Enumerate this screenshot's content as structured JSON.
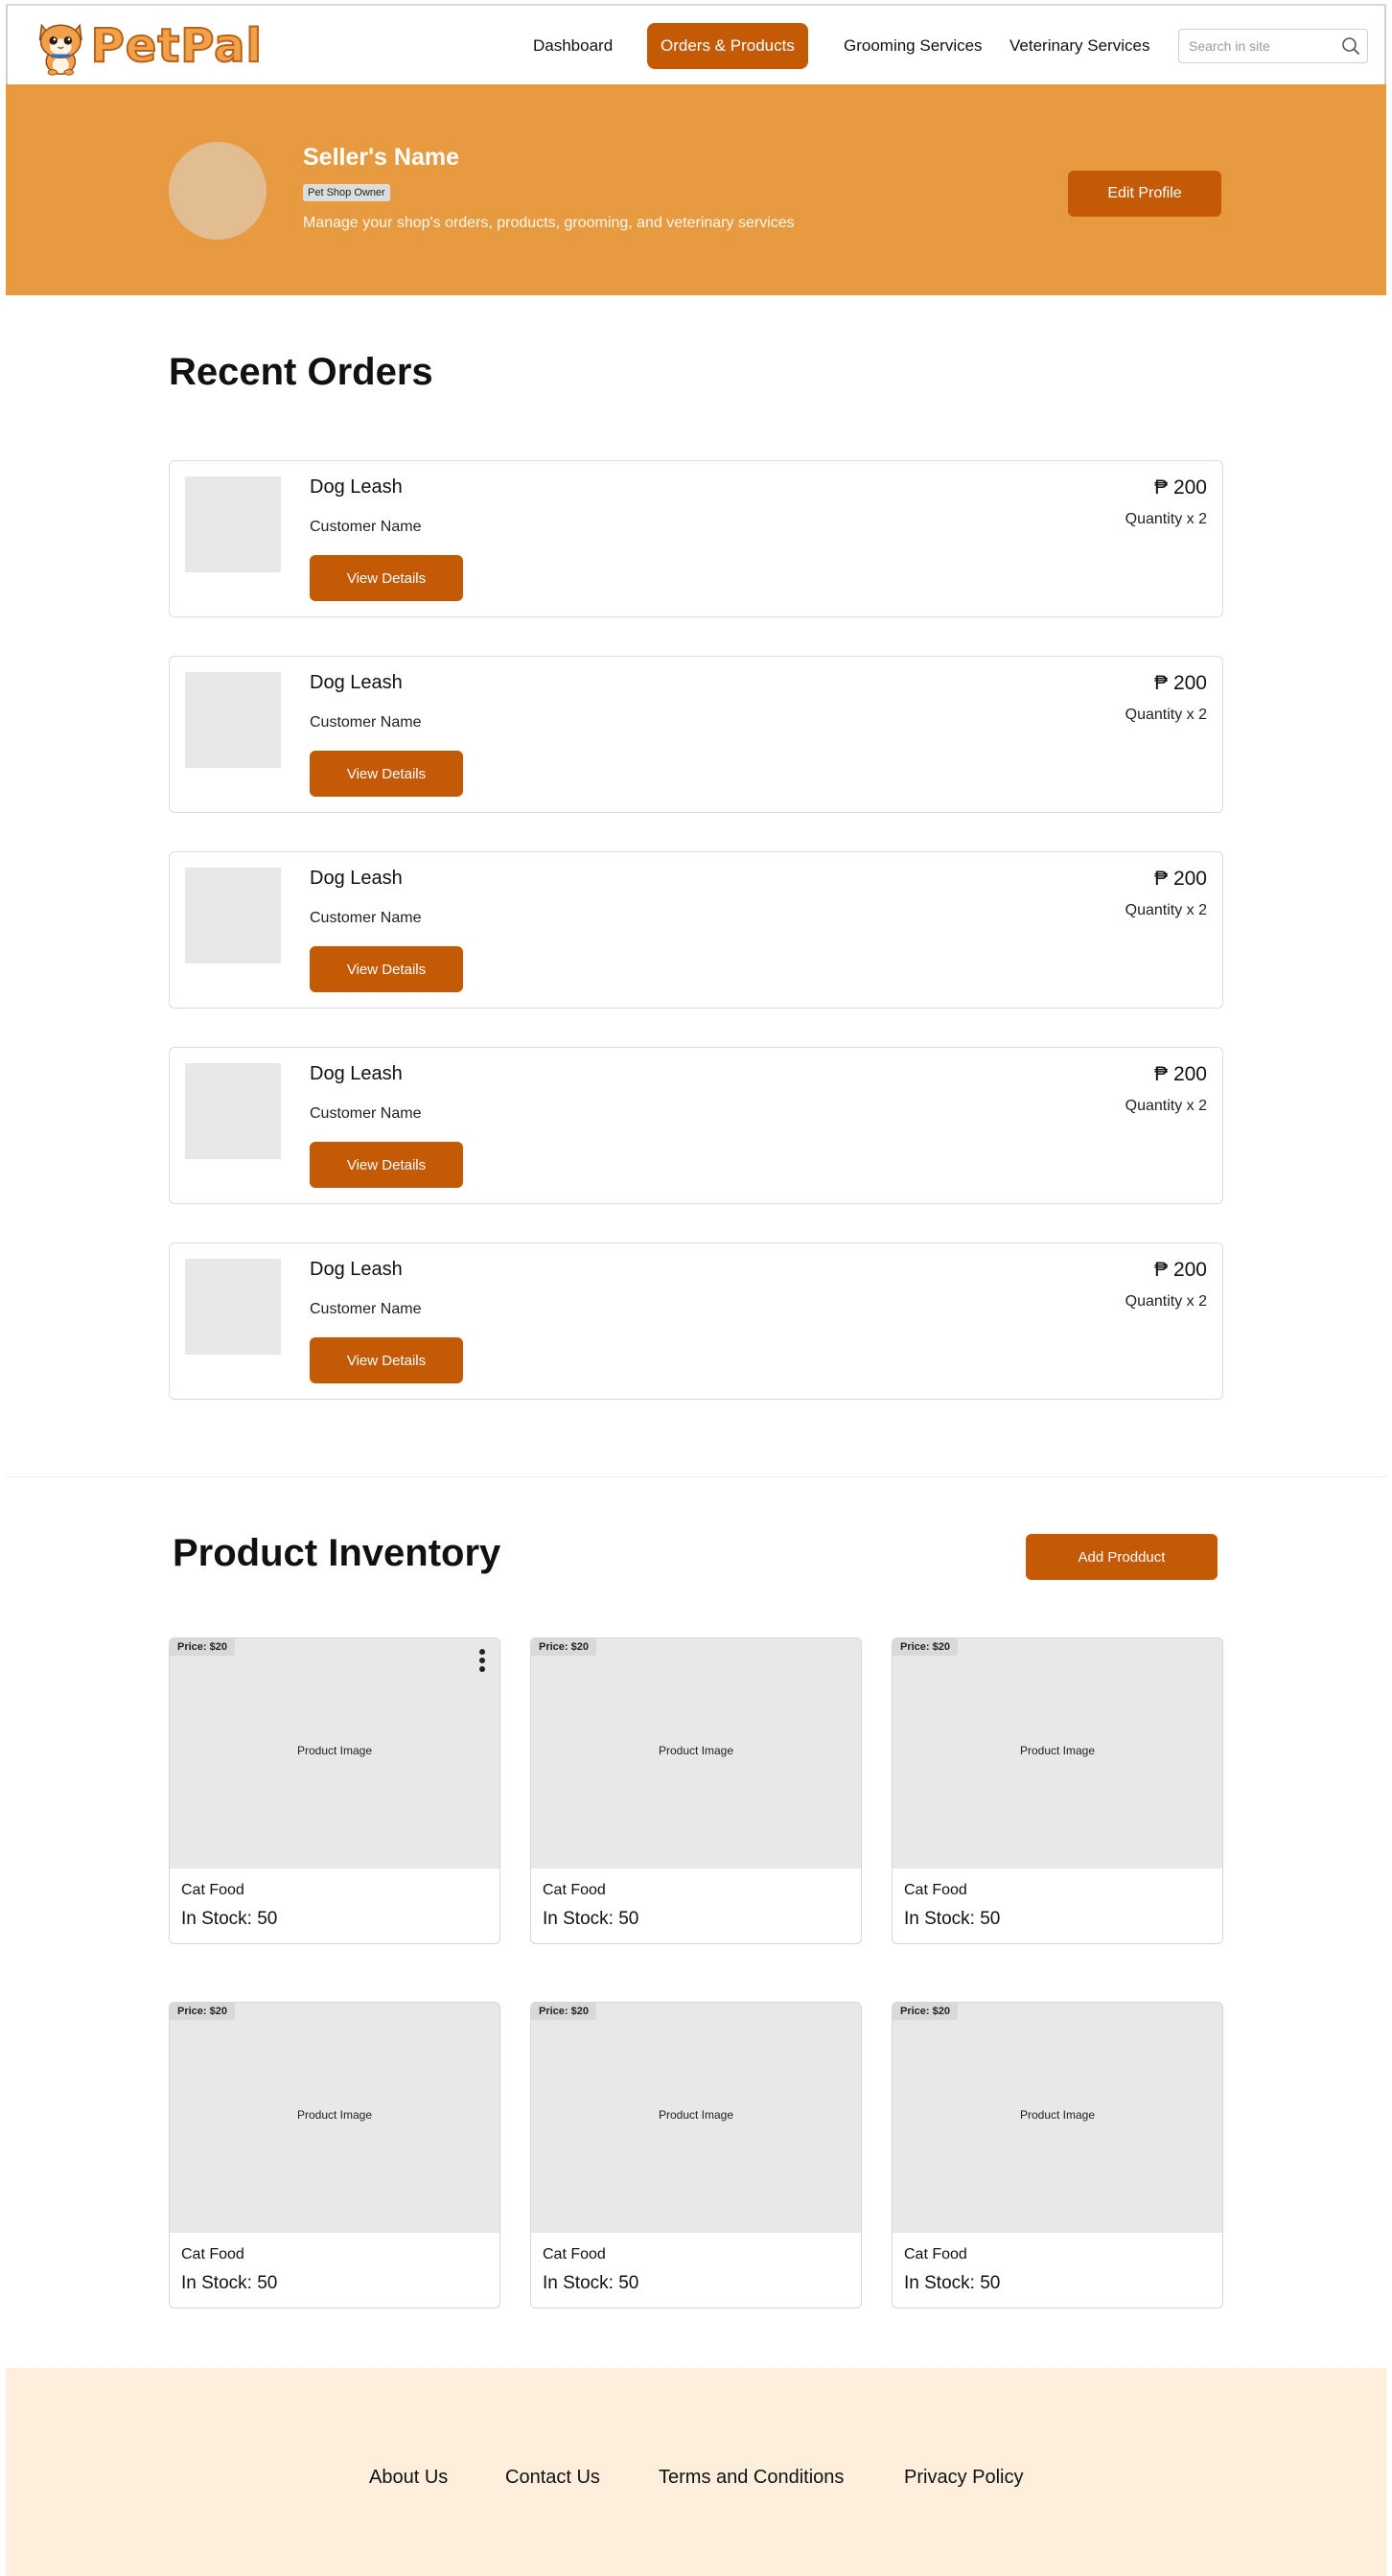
{
  "brand": {
    "name": "PetPal"
  },
  "nav": {
    "links": [
      {
        "label": "Dashboard",
        "active": false
      },
      {
        "label": "Orders & Products",
        "active": true
      },
      {
        "label": "Grooming Services",
        "active": false
      },
      {
        "label": "Veterinary Services",
        "active": false
      }
    ],
    "search_placeholder": "Search in site"
  },
  "hero": {
    "seller_name": "Seller's Name",
    "role_badge": "Pet Shop Owner",
    "description": "Manage your shop's orders, products, grooming, and veterinary services",
    "edit_label": "Edit Profile"
  },
  "orders": {
    "title": "Recent Orders",
    "items": [
      {
        "name": "Dog Leash",
        "customer": "Customer Name",
        "price": "₱ 200",
        "quantity": "Quantity x 2",
        "button": "View Details"
      },
      {
        "name": "Dog Leash",
        "customer": "Customer Name",
        "price": "₱ 200",
        "quantity": "Quantity x 2",
        "button": "View Details"
      },
      {
        "name": "Dog Leash",
        "customer": "Customer Name",
        "price": "₱ 200",
        "quantity": "Quantity x 2",
        "button": "View Details"
      },
      {
        "name": "Dog Leash",
        "customer": "Customer Name",
        "price": "₱ 200",
        "quantity": "Quantity x 2",
        "button": "View Details"
      },
      {
        "name": "Dog Leash",
        "customer": "Customer Name",
        "price": "₱ 200",
        "quantity": "Quantity x 2",
        "button": "View Details"
      }
    ]
  },
  "inventory": {
    "title": "Product Inventory",
    "add_label": "Add Prodduct",
    "products": [
      {
        "price": "Price: $20",
        "image_label": "Product Image",
        "name": "Cat Food",
        "stock": "In Stock: 50"
      },
      {
        "price": "Price: $20",
        "image_label": "Product Image",
        "name": "Cat Food",
        "stock": "In Stock: 50"
      },
      {
        "price": "Price: $20",
        "image_label": "Product Image",
        "name": "Cat Food",
        "stock": "In Stock: 50"
      },
      {
        "price": "Price: $20",
        "image_label": "Product Image",
        "name": "Cat Food",
        "stock": "In Stock: 50"
      },
      {
        "price": "Price: $20",
        "image_label": "Product Image",
        "name": "Cat Food",
        "stock": "In Stock: 50"
      },
      {
        "price": "Price: $20",
        "image_label": "Product Image",
        "name": "Cat Food",
        "stock": "In Stock: 50"
      }
    ]
  },
  "footer": {
    "links": [
      "About Us",
      "Contact Us",
      "Terms and Conditions",
      "Privacy Policy"
    ]
  },
  "colors": {
    "accent": "#c45a05",
    "hero_bg": "#e89a40",
    "footer_bg": "#fdefdc"
  }
}
